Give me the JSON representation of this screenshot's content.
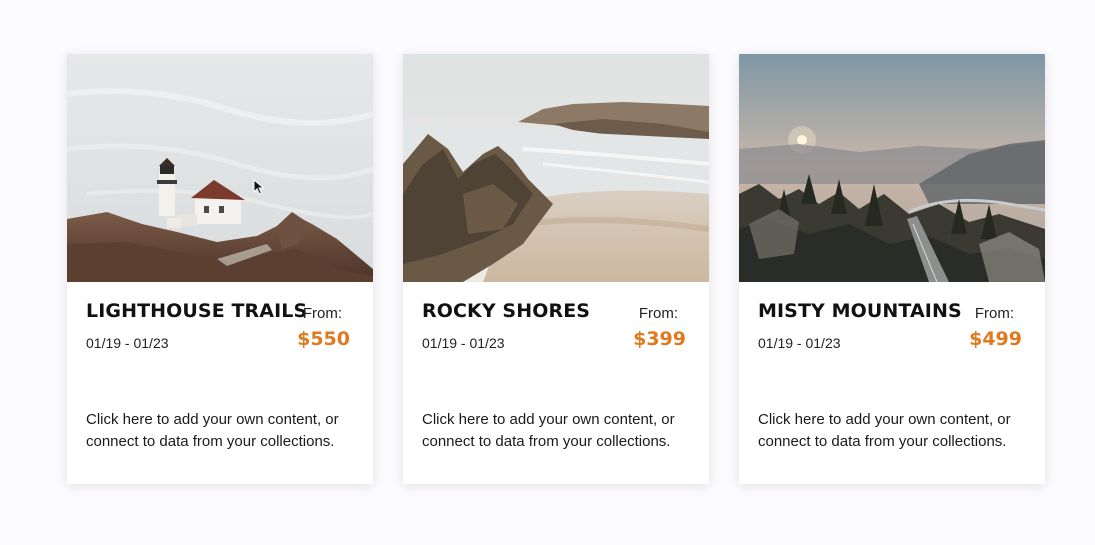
{
  "colors": {
    "page_background": "#fbfafd",
    "card_background": "#ffffff",
    "price": "#e07a1f",
    "title": "#111111"
  },
  "cards": [
    {
      "title": "LIGHTHOUSE TRAILS",
      "dates": "01/19 - 01/23",
      "from_label": "From:",
      "price": "$550",
      "description": "Click here to add your own content, or connect to data from your collections.",
      "image": "lighthouse-photo"
    },
    {
      "title": "ROCKY SHORES",
      "dates": "01/19 - 01/23",
      "from_label": "From:",
      "price": "$399",
      "description": "Click here to add your own content, or connect to data from your collections.",
      "image": "rocky-shore-photo"
    },
    {
      "title": "MISTY MOUNTAINS",
      "dates": "01/19 - 01/23",
      "from_label": "From:",
      "price": "$499",
      "description": "Click here to add your own content, or connect to data from your collections.",
      "image": "misty-mountain-photo"
    }
  ],
  "cursor": {
    "icon": "arrow-pointer-icon"
  }
}
